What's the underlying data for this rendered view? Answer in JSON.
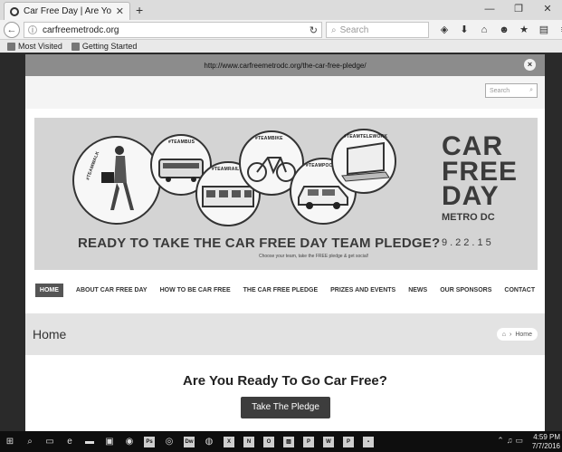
{
  "browser": {
    "tab_title": "Car Free Day | Are You Re...",
    "tab_close": "✕",
    "new_tab": "+",
    "url": "carfreemetrodc.org",
    "search_placeholder": "Search",
    "bookmarks": [
      "Most Visited",
      "Getting Started"
    ]
  },
  "overlay": {
    "url": "http://www.carfreemetrodc.org/the-car-free-pledge/",
    "close": "×"
  },
  "site": {
    "search_placeholder": "Search",
    "banner": {
      "teams": [
        "#TEAMWALK",
        "#TEAMBUS",
        "#TEAMRAIL",
        "#TEAMBIKE",
        "#TEAMPOOL",
        "#TEAMTELEWORK"
      ],
      "headline": "READY TO TAKE THE CAR FREE DAY TEAM PLEDGE?",
      "sub": "Choose your team, take the FREE pledge & get social!",
      "logo_line1": "CAR",
      "logo_line2": "FREE",
      "logo_line3": "DAY",
      "logo_metro": "METRO DC",
      "logo_date": "9.22.15"
    },
    "nav": [
      "HOME",
      "ABOUT CAR FREE DAY",
      "HOW TO BE CAR FREE",
      "THE CAR FREE PLEDGE",
      "PRIZES AND EVENTS",
      "NEWS",
      "OUR SPONSORS",
      "CONTACT"
    ],
    "page_title": "Home",
    "breadcrumb": "Home",
    "hero_question": "Are You Ready To Go Car Free?",
    "cta": "Take The Pledge"
  },
  "taskbar": {
    "time": "4:59 PM",
    "date": "7/7/2016"
  }
}
